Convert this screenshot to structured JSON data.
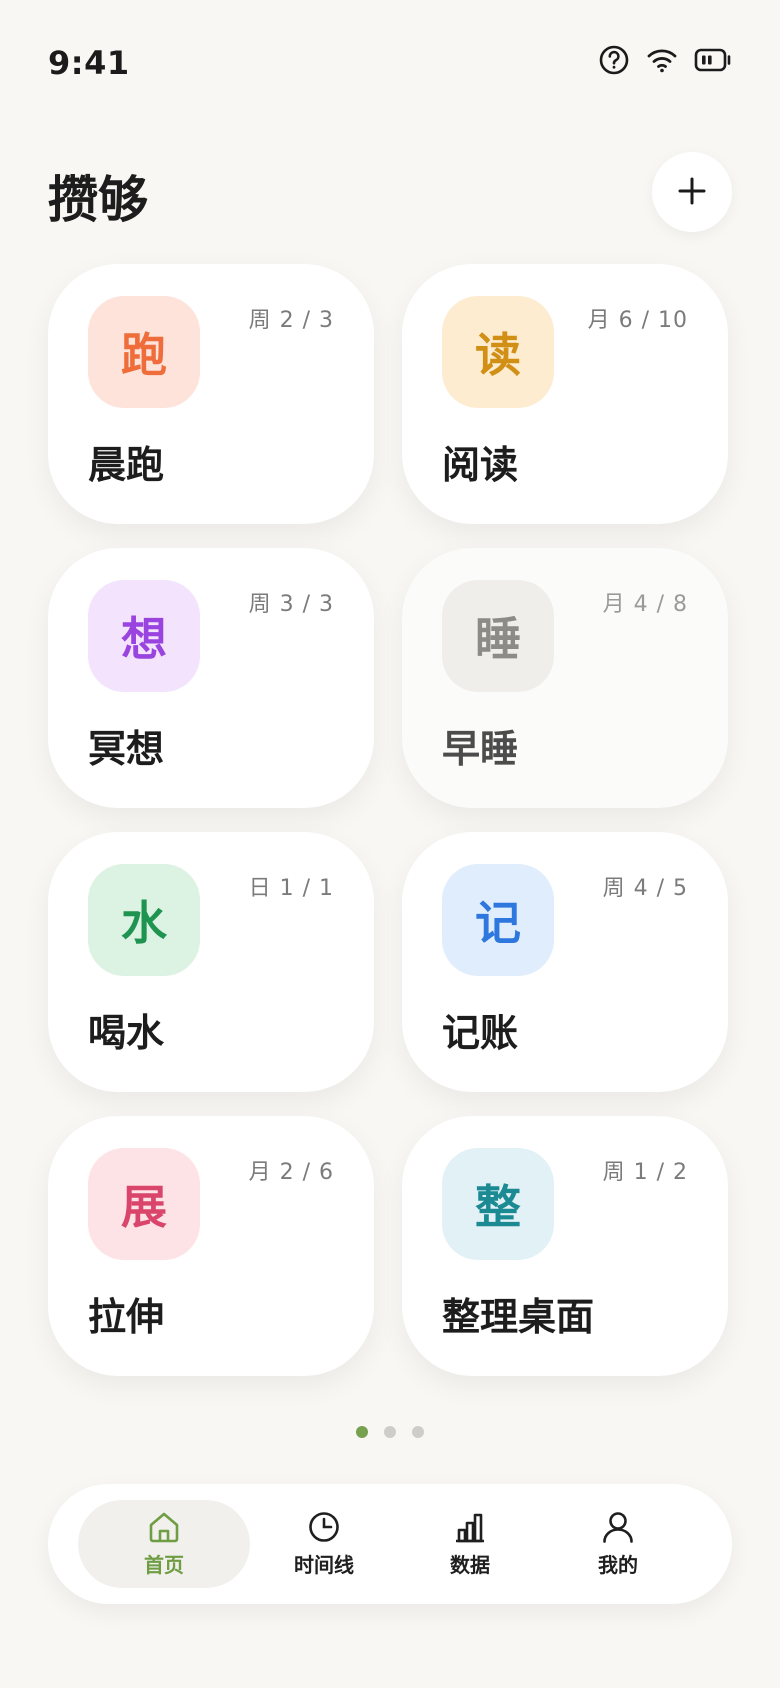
{
  "status_bar": {
    "time": "9:41",
    "icons": [
      "help-circle-icon",
      "wifi-icon",
      "battery-icon"
    ]
  },
  "header": {
    "title": "攒够",
    "add_icon": "plus-icon"
  },
  "cards": [
    {
      "glyph": "跑",
      "name": "晨跑",
      "progress": "周 2 / 3",
      "icon_bg": "#fde3da",
      "icon_color": "#ee6d3a",
      "muted": false
    },
    {
      "glyph": "读",
      "name": "阅读",
      "progress": "月 6 / 10",
      "icon_bg": "#fdecd0",
      "icon_color": "#d18f16",
      "muted": false
    },
    {
      "glyph": "想",
      "name": "冥想",
      "progress": "周 3 / 3",
      "icon_bg": "#f3e3fc",
      "icon_color": "#9a44e0",
      "muted": false
    },
    {
      "glyph": "睡",
      "name": "早睡",
      "progress": "月 4 / 8",
      "icon_bg": "#efeeea",
      "icon_color": "#8d8b87",
      "muted": true
    },
    {
      "glyph": "水",
      "name": "喝水",
      "progress": "日 1 / 1",
      "icon_bg": "#dcf2e3",
      "icon_color": "#1f9450",
      "muted": false
    },
    {
      "glyph": "记",
      "name": "记账",
      "progress": "周 4 / 5",
      "icon_bg": "#e0edfd",
      "icon_color": "#2e77de",
      "muted": false
    },
    {
      "glyph": "展",
      "name": "拉伸",
      "progress": "月 2 / 6",
      "icon_bg": "#fde3e6",
      "icon_color": "#d9456b",
      "muted": false
    },
    {
      "glyph": "整",
      "name": "整理桌面",
      "progress": "周 1 / 2",
      "icon_bg": "#e2f1f6",
      "icon_color": "#1c8a92",
      "muted": false
    }
  ],
  "pager": {
    "count": 3,
    "active": 0,
    "active_color": "#78a14f"
  },
  "nav": {
    "items": [
      {
        "label": "首页",
        "icon": "home-icon",
        "active": true
      },
      {
        "label": "时间线",
        "icon": "clock-icon",
        "active": false
      },
      {
        "label": "数据",
        "icon": "bar-chart-icon",
        "active": false
      },
      {
        "label": "我的",
        "icon": "user-icon",
        "active": false
      }
    ],
    "active_color": "#6f9d43"
  }
}
